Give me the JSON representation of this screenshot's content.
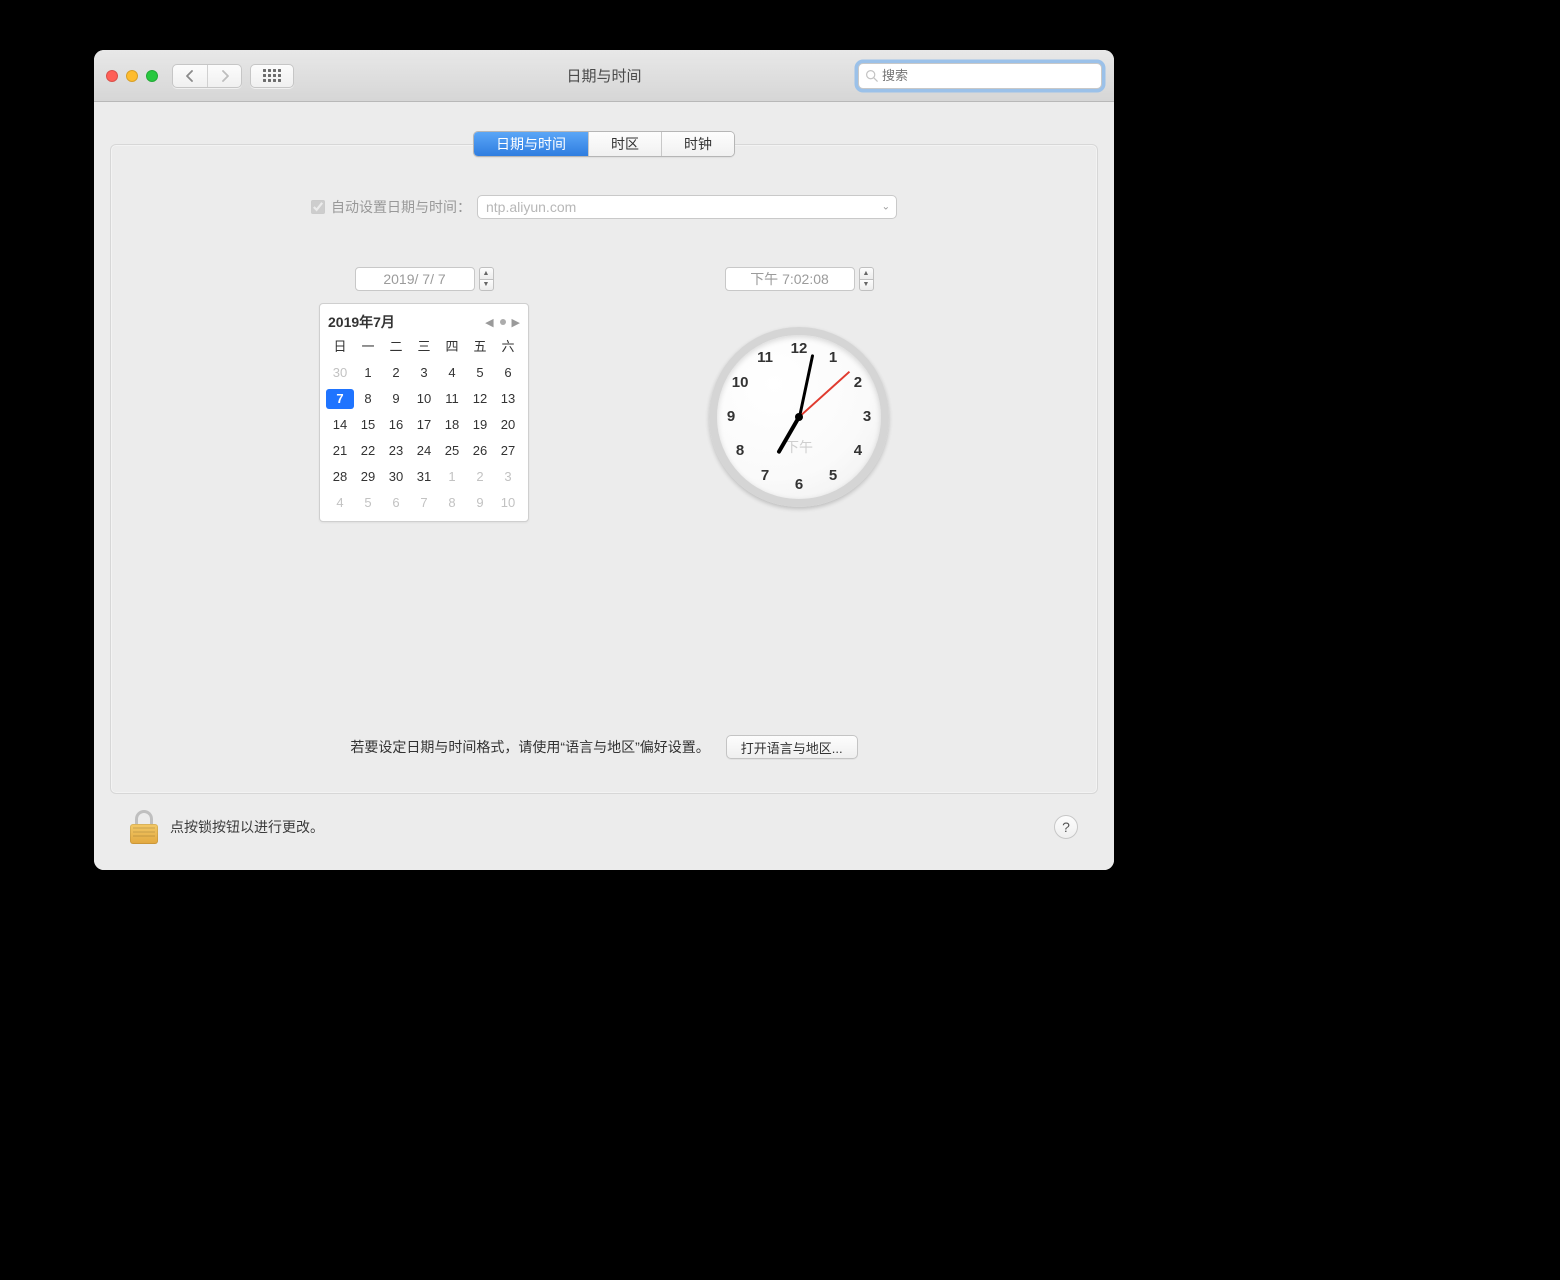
{
  "window": {
    "title": "日期与时间",
    "search_placeholder": "搜索"
  },
  "tabs": {
    "date_time": "日期与时间",
    "timezone": "时区",
    "clock": "时钟"
  },
  "auto_set": {
    "label": "自动设置日期与时间：",
    "checked": true,
    "server": "ntp.aliyun.com"
  },
  "date_field": {
    "value": "2019/ 7/ 7"
  },
  "time_field": {
    "value": "下午 7:02:08"
  },
  "calendar": {
    "month_label": "2019年7月",
    "dow": [
      "日",
      "一",
      "二",
      "三",
      "四",
      "五",
      "六"
    ],
    "leading_other": [
      30
    ],
    "days": [
      1,
      2,
      3,
      4,
      5,
      6,
      7,
      8,
      9,
      10,
      11,
      12,
      13,
      14,
      15,
      16,
      17,
      18,
      19,
      20,
      21,
      22,
      23,
      24,
      25,
      26,
      27,
      28,
      29,
      30,
      31
    ],
    "trailing_other": [
      1,
      2,
      3,
      4,
      5,
      6,
      7,
      8,
      9,
      10
    ],
    "selected_day": 7
  },
  "clock": {
    "ampm": "下午",
    "hour_angle": 210,
    "minute_angle": 12,
    "second_angle": 48,
    "numbers": [
      "12",
      "1",
      "2",
      "3",
      "4",
      "5",
      "6",
      "7",
      "8",
      "9",
      "10",
      "11"
    ]
  },
  "format_row": {
    "text": "若要设定日期与时间格式，请使用“语言与地区”偏好设置。",
    "button": "打开语言与地区..."
  },
  "footer": {
    "lock_text": "点按锁按钮以进行更改。",
    "help": "?"
  }
}
